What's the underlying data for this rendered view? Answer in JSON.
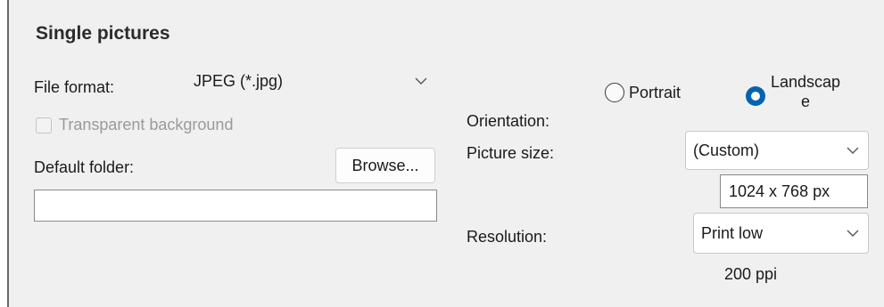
{
  "section": {
    "title": "Single pictures"
  },
  "file_format": {
    "label": "File format:",
    "value": "JPEG (*.jpg)"
  },
  "transparent_bg": {
    "label": "Transparent background",
    "checked": false,
    "enabled": false
  },
  "default_folder": {
    "label": "Default folder:",
    "browse_label": "Browse...",
    "value": ""
  },
  "orientation": {
    "label": "Orientation:",
    "options": [
      {
        "label": "Portrait",
        "selected": false
      },
      {
        "label_line1": "Landscap",
        "label_line2": "e",
        "selected": true
      }
    ]
  },
  "picture_size": {
    "label": "Picture size:",
    "value": "(Custom)",
    "dimensions": "1024 x 768 px"
  },
  "resolution": {
    "label": "Resolution:",
    "value": "Print low",
    "ppi": "200 ppi"
  },
  "colors": {
    "panel_bg": "#f0f0f0",
    "accent": "#0063b1"
  }
}
